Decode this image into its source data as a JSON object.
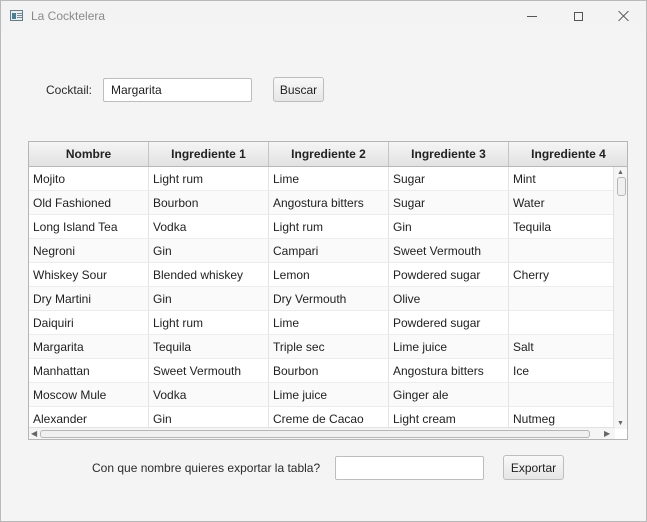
{
  "window": {
    "title": "La Cocktelera"
  },
  "search": {
    "label": "Cocktail:",
    "value": "Margarita",
    "button_label": "Buscar"
  },
  "table": {
    "columns": [
      "Nombre",
      "Ingrediente 1",
      "Ingrediente 2",
      "Ingrediente 3",
      "Ingrediente 4"
    ],
    "rows": [
      [
        "Mojito",
        "Light rum",
        "Lime",
        "Sugar",
        "Mint"
      ],
      [
        "Old Fashioned",
        "Bourbon",
        "Angostura bitters",
        "Sugar",
        "Water"
      ],
      [
        "Long Island Tea",
        "Vodka",
        "Light rum",
        "Gin",
        "Tequila"
      ],
      [
        "Negroni",
        "Gin",
        "Campari",
        "Sweet Vermouth",
        ""
      ],
      [
        "Whiskey Sour",
        "Blended whiskey",
        "Lemon",
        "Powdered sugar",
        "Cherry"
      ],
      [
        "Dry Martini",
        "Gin",
        "Dry Vermouth",
        "Olive",
        ""
      ],
      [
        "Daiquiri",
        "Light rum",
        "Lime",
        "Powdered sugar",
        ""
      ],
      [
        "Margarita",
        "Tequila",
        "Triple sec",
        "Lime juice",
        "Salt"
      ],
      [
        "Manhattan",
        "Sweet Vermouth",
        "Bourbon",
        "Angostura bitters",
        "Ice"
      ],
      [
        "Moscow Mule",
        "Vodka",
        "Lime juice",
        "Ginger ale",
        ""
      ],
      [
        "Alexander",
        "Gin",
        "Creme de Cacao",
        "Light cream",
        "Nutmeg"
      ]
    ]
  },
  "export": {
    "label": "Con que nombre quieres exportar la tabla?",
    "value": "",
    "button_label": "Exportar"
  },
  "icons": {
    "app": "app-window-icon",
    "minimize": "minimize-icon",
    "maximize": "maximize-icon",
    "close": "close-icon"
  }
}
